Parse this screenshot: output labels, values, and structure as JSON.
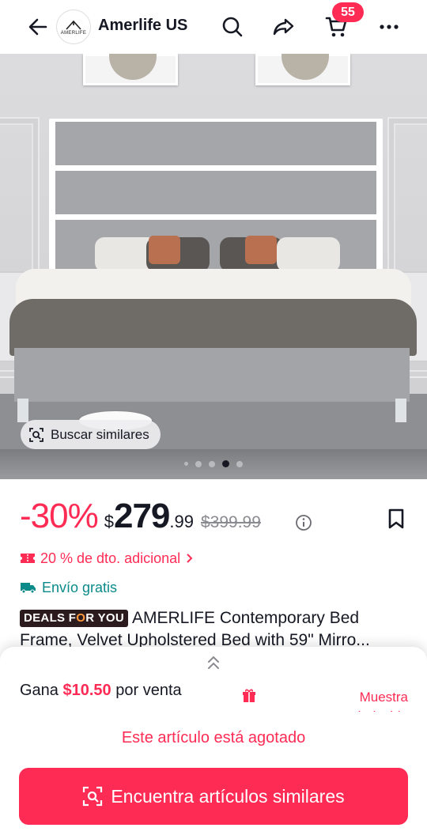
{
  "header": {
    "logo_text": "AMERLIFE",
    "store_name": "Amerlife US",
    "cart_count": "55",
    "icons": [
      "back-arrow-icon",
      "search-icon",
      "share-icon",
      "cart-icon",
      "more-icon"
    ]
  },
  "gallery": {
    "similar_button": "Buscar similares",
    "page_count": 5,
    "active_index": 3
  },
  "price": {
    "discount": "-30%",
    "currency": "$",
    "integer": "279",
    "decimals": ".99",
    "original": "$399.99"
  },
  "promo": {
    "coupon": "20 % de dto. adicional",
    "shipping": "Envío gratis"
  },
  "product": {
    "badge_part1": "DEALS F",
    "badge_highlight": "O",
    "badge_part2": "R YOU",
    "title": "AMERLIFE Contemporary Bed Frame, Velvet Upholstered Bed with 59\" Mirro..."
  },
  "affiliate": {
    "earn_prefix": "Gana",
    "earn_amount": "$10.50",
    "earn_suffix": "por venta",
    "sample_text": "Muestra reembolsable"
  },
  "footer": {
    "soldout": "Este artículo está agotado",
    "find_similar": "Encuentra artículos similares"
  },
  "colors": {
    "accent": "#fe2c55",
    "shipping": "#0b8a8a",
    "text": "#161823"
  }
}
